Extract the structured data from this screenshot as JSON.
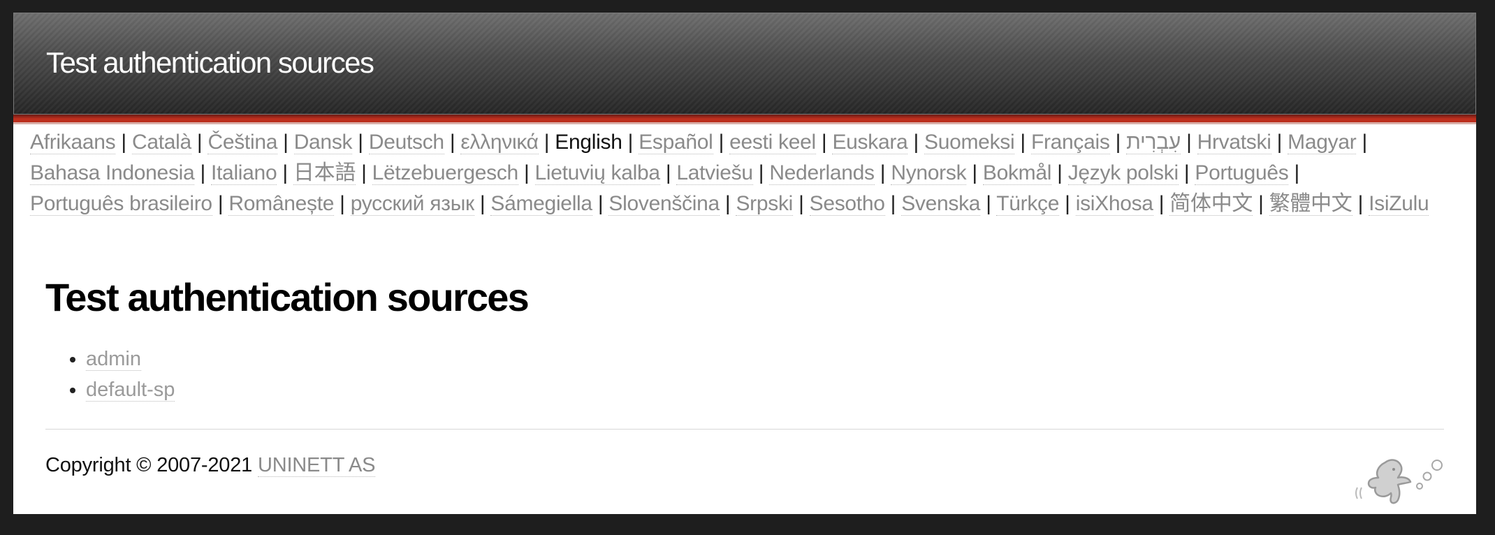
{
  "header": {
    "title": "Test authentication sources"
  },
  "languages": [
    {
      "label": "Afrikaans",
      "current": false
    },
    {
      "label": "Català",
      "current": false
    },
    {
      "label": "Čeština",
      "current": false
    },
    {
      "label": "Dansk",
      "current": false
    },
    {
      "label": "Deutsch",
      "current": false
    },
    {
      "label": "ελληνικά",
      "current": false
    },
    {
      "label": "English",
      "current": true
    },
    {
      "label": "Español",
      "current": false
    },
    {
      "label": "eesti keel",
      "current": false
    },
    {
      "label": "Euskara",
      "current": false
    },
    {
      "label": "Suomeksi",
      "current": false
    },
    {
      "label": "Français",
      "current": false
    },
    {
      "label": "עִבְרִית",
      "current": false
    },
    {
      "label": "Hrvatski",
      "current": false
    },
    {
      "label": "Magyar",
      "current": false
    },
    {
      "label": "Bahasa Indonesia",
      "current": false
    },
    {
      "label": "Italiano",
      "current": false
    },
    {
      "label": "日本語",
      "current": false
    },
    {
      "label": "Lëtzebuergesch",
      "current": false
    },
    {
      "label": "Lietuvių kalba",
      "current": false
    },
    {
      "label": "Latviešu",
      "current": false
    },
    {
      "label": "Nederlands",
      "current": false
    },
    {
      "label": "Nynorsk",
      "current": false
    },
    {
      "label": "Bokmål",
      "current": false
    },
    {
      "label": "Język polski",
      "current": false
    },
    {
      "label": "Português",
      "current": false
    },
    {
      "label": "Português brasileiro",
      "current": false
    },
    {
      "label": "Românește",
      "current": false
    },
    {
      "label": "русский язык",
      "current": false
    },
    {
      "label": "Sámegiella",
      "current": false
    },
    {
      "label": "Slovenščina",
      "current": false
    },
    {
      "label": "Srpski",
      "current": false
    },
    {
      "label": "Sesotho",
      "current": false
    },
    {
      "label": "Svenska",
      "current": false
    },
    {
      "label": "Türkçe",
      "current": false
    },
    {
      "label": "isiXhosa",
      "current": false
    },
    {
      "label": "简体中文",
      "current": false
    },
    {
      "label": "繁體中文",
      "current": false
    },
    {
      "label": "IsiZulu",
      "current": false
    }
  ],
  "language_separator": "|",
  "main": {
    "title": "Test authentication sources",
    "sources": [
      "admin",
      "default-sp"
    ]
  },
  "footer": {
    "copyright": "Copyright © 2007-2021",
    "company_link": "UNINETT AS"
  },
  "logo": {
    "icon": "simplesamlphp-logo-icon"
  }
}
